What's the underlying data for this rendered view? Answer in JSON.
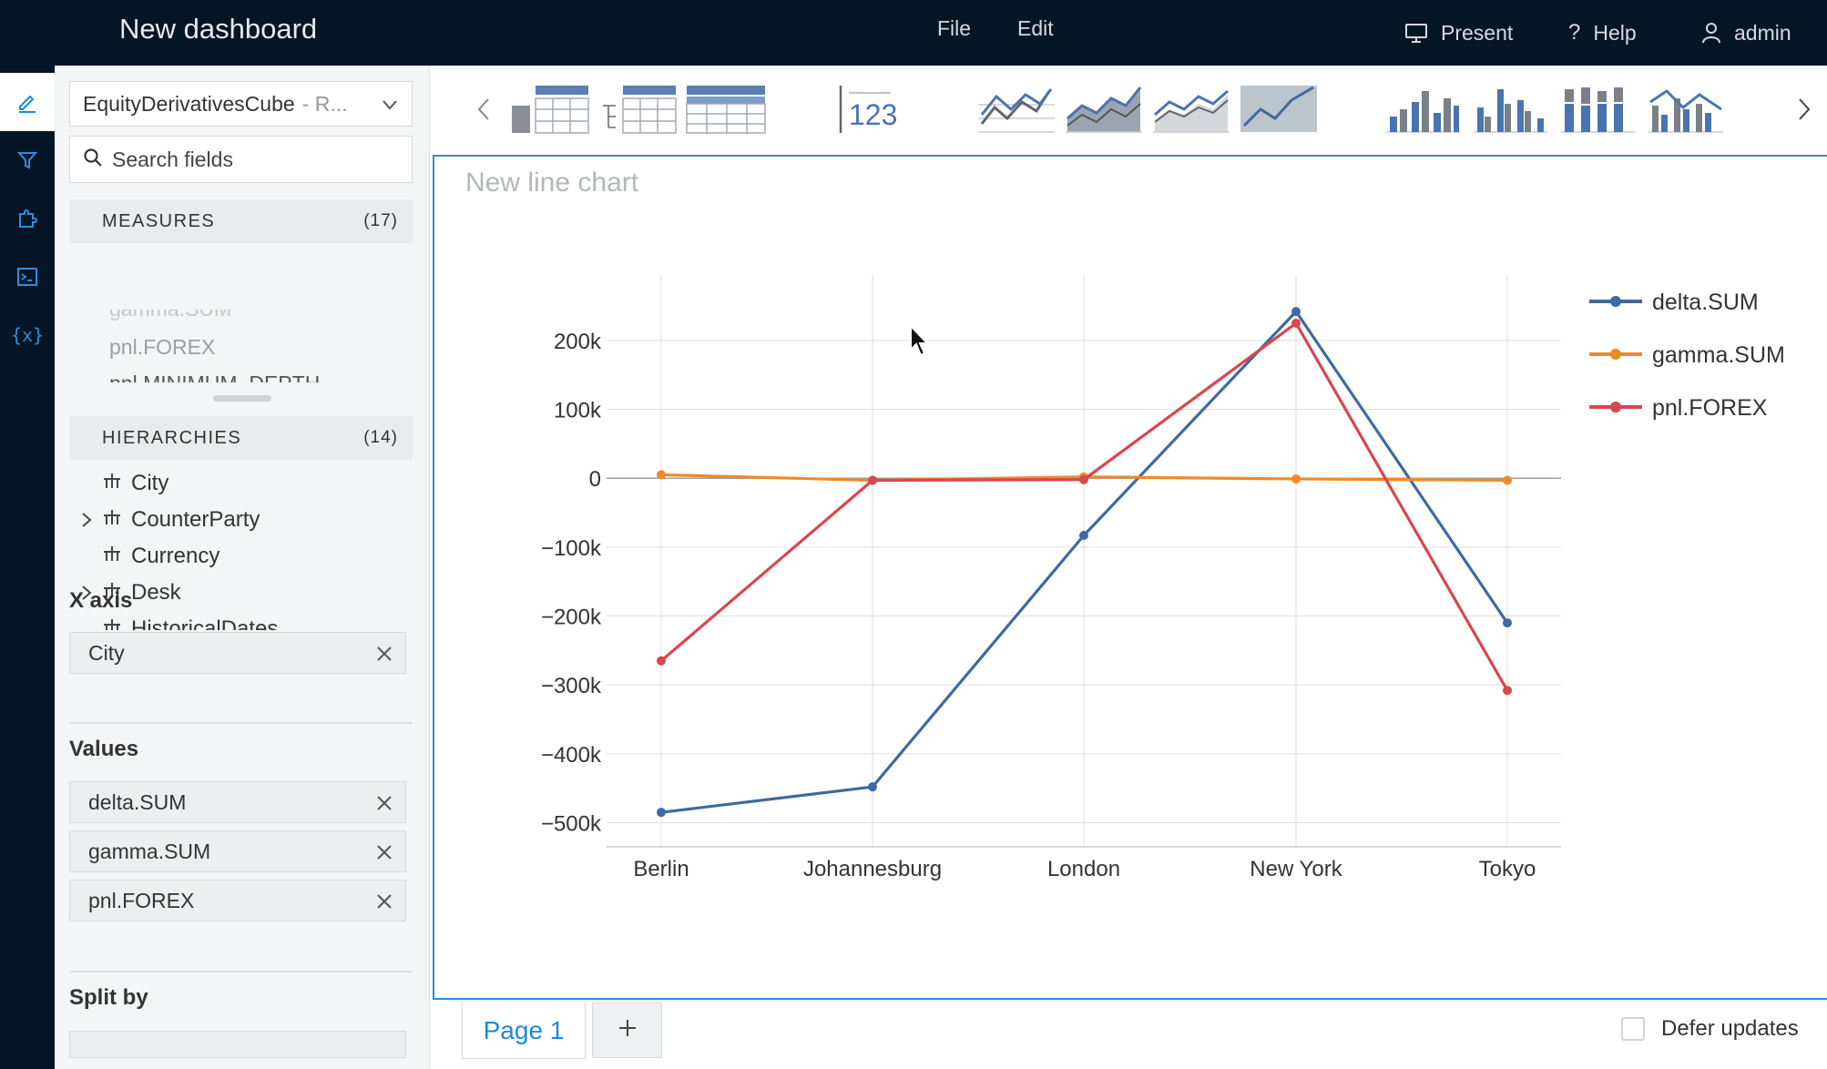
{
  "header": {
    "title": "New dashboard",
    "menu": [
      "File",
      "Edit"
    ],
    "present_label": "Present",
    "help_label": "Help",
    "user_label": "admin"
  },
  "rail": {
    "icons": [
      "pencil-icon",
      "filter-icon",
      "puzzle-icon",
      "terminal-icon",
      "variable-icon"
    ],
    "active": "pencil-icon"
  },
  "panel": {
    "cube": {
      "name": "EquityDerivativesCube",
      "suffix": "- R..."
    },
    "search_placeholder": "Search fields",
    "measures": {
      "label": "MEASURES",
      "count": "(17)",
      "items": [
        "pnl.FOREX",
        "pnl.MINIMUM_DEPTH"
      ]
    },
    "hierarchies": {
      "label": "HIERARCHIES",
      "count": "(14)",
      "items": [
        {
          "label": "City",
          "expandable": false
        },
        {
          "label": "CounterParty",
          "expandable": true
        },
        {
          "label": "Currency",
          "expandable": false
        },
        {
          "label": "Desk",
          "expandable": true
        },
        {
          "label": "HistoricalDates",
          "expandable": false
        }
      ]
    },
    "x_axis": {
      "label": "X axis",
      "items": [
        "City"
      ]
    },
    "values": {
      "label": "Values",
      "items": [
        "delta.SUM",
        "gamma.SUM",
        "pnl.FOREX"
      ]
    },
    "split_by": {
      "label": "Split by"
    }
  },
  "toolbar": {
    "widgets": [
      "table",
      "tree-table",
      "pivot-table",
      "kpi",
      "line-chart",
      "stacked-area-chart",
      "area-chart",
      "single-area-chart",
      "column-chart",
      "clustered-column-chart",
      "stacked-column-chart",
      "combo-chart"
    ],
    "kpi_text": "123"
  },
  "chart": {
    "title_placeholder": "New line chart"
  },
  "chart_data": {
    "type": "line",
    "categories": [
      "Berlin",
      "Johannesburg",
      "London",
      "New York",
      "Tokyo"
    ],
    "series": [
      {
        "name": "delta.SUM",
        "color": "#3d6aa0",
        "values": [
          -485000,
          -448000,
          -83000,
          242000,
          -210000
        ]
      },
      {
        "name": "gamma.SUM",
        "color": "#ee8a2b",
        "values": [
          5000,
          -3000,
          2000,
          -1000,
          -3000
        ]
      },
      {
        "name": "pnl.FOREX",
        "color": "#d9464e",
        "values": [
          -265000,
          -3000,
          -2000,
          225000,
          -308000
        ]
      }
    ],
    "yticks": [
      200000,
      100000,
      0,
      -100000,
      -200000,
      -300000,
      -400000,
      -500000
    ],
    "ytick_labels": [
      "200k",
      "100k",
      "0",
      "−100k",
      "−200k",
      "−300k",
      "−400k",
      "−500k"
    ],
    "ylim": [
      -535000,
      295000
    ],
    "grid": true,
    "legend": "top-right"
  },
  "footer": {
    "page_label": "Page 1",
    "add_label": "+",
    "defer_label": "Defer updates"
  }
}
